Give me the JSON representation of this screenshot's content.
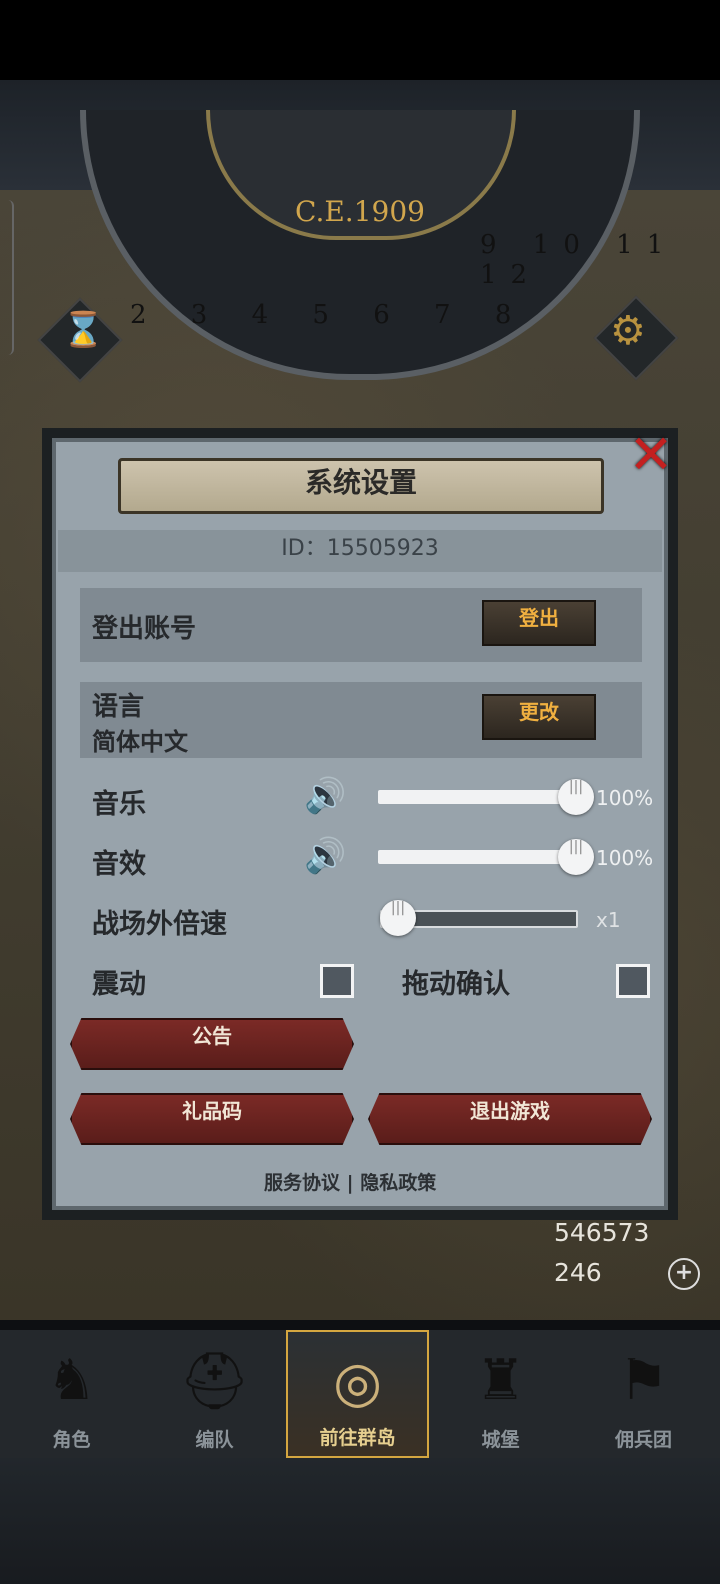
{
  "hud": {
    "year": "C.E.1909",
    "dial_numbers_left": "2 3 4 5 6 7 8",
    "dial_numbers_right": "9 10 11 12",
    "hourglass_icon": "hourglass-icon",
    "settings_icon": "gear-icon"
  },
  "dialog": {
    "title": "系统设置",
    "id_text": "ID：15505923",
    "logout_label": "登出账号",
    "logout_button": "登出",
    "language_label": "语言",
    "language_value": "简体中文",
    "change_button": "更改",
    "music_label": "音乐",
    "music_pct": "100%",
    "music_level": 1.0,
    "sfx_label": "音效",
    "sfx_pct": "100%",
    "sfx_level": 1.0,
    "speed_label": "战场外倍速",
    "speed_value": "x1",
    "vibrate_label": "震动",
    "drag_confirm_label": "拖动确认",
    "vibrate_checked": false,
    "drag_confirm_checked": false,
    "notice_button": "公告",
    "gift_code_button": "礼品码",
    "exit_button": "退出游戏",
    "service_link": "服务协议",
    "separator": "|",
    "privacy_link": "隐私政策",
    "close_icon": "close-icon"
  },
  "resources": {
    "silver": "546573",
    "crystal": "246"
  },
  "nav": [
    {
      "label": "角色",
      "icon": "knight-icon"
    },
    {
      "label": "编队",
      "icon": "helmet-icon"
    },
    {
      "label": "前往群岛",
      "icon": "compass-icon",
      "active": true
    },
    {
      "label": "城堡",
      "icon": "castle-icon"
    },
    {
      "label": "佣兵团",
      "icon": "mercenary-icon"
    }
  ],
  "colors": {
    "accent": "#d4a640",
    "danger": "#c42020",
    "panel": "#98a3ab"
  }
}
